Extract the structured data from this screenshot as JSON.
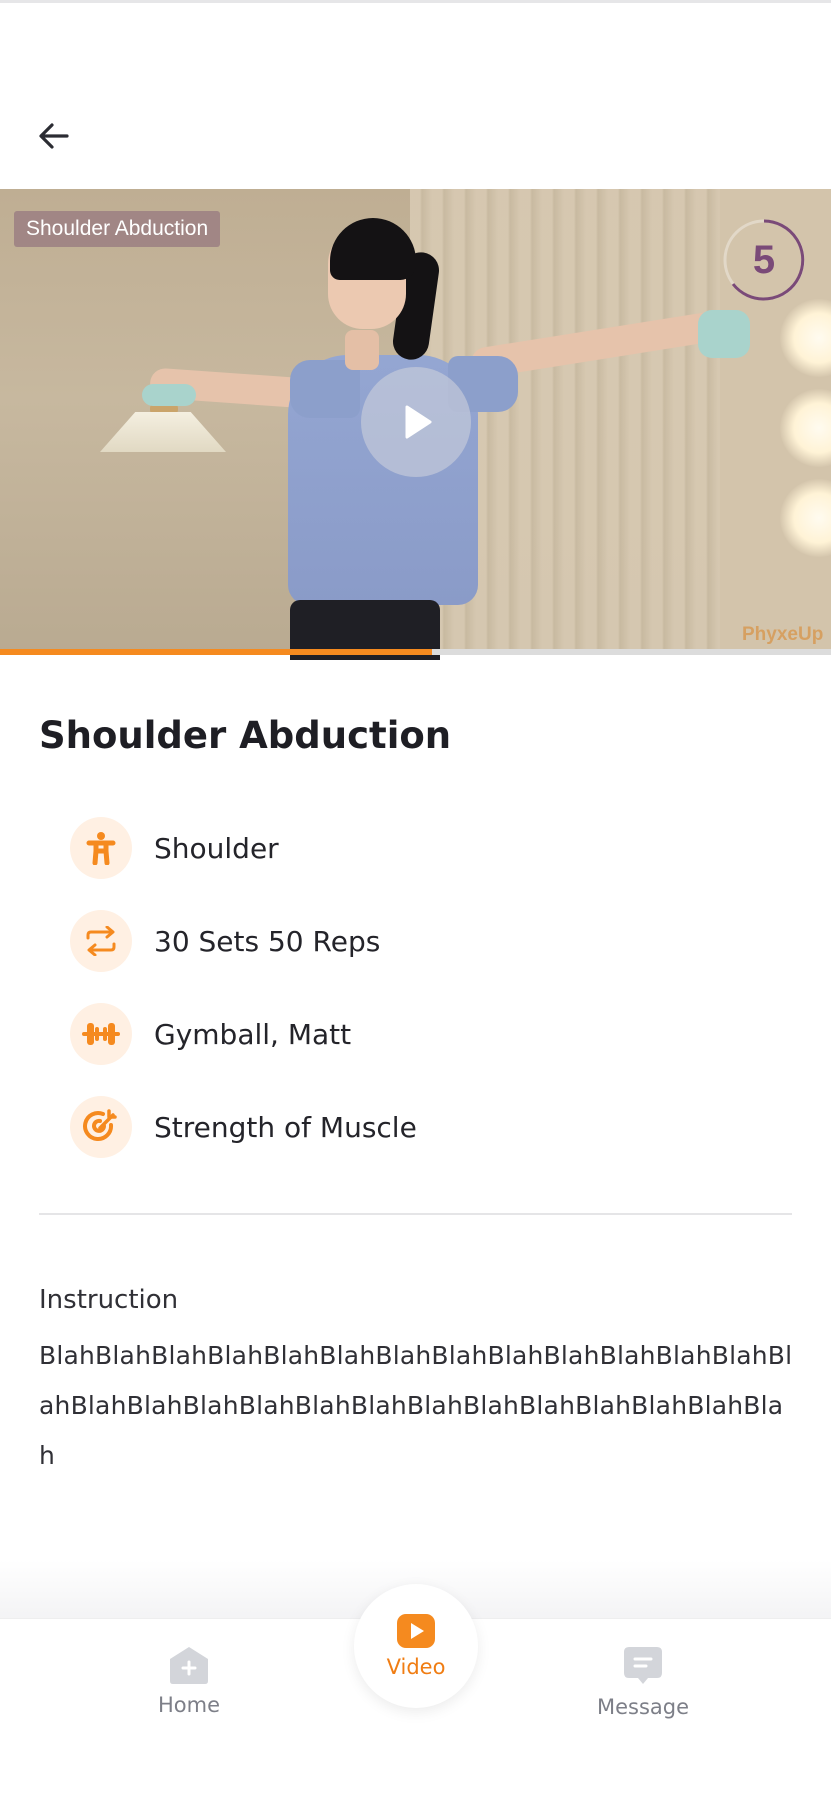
{
  "header": {
    "back_icon": "arrow-left-icon"
  },
  "video": {
    "overlay_title": "Shoulder Abduction",
    "counter": "5",
    "watermark": "PhyxeUp",
    "play_icon": "play-icon",
    "progress_fraction": 0.52,
    "accent_color": "#f58a1f"
  },
  "exercise": {
    "title": "Shoulder Abduction",
    "details": [
      {
        "icon": "person-icon",
        "text": "Shoulder"
      },
      {
        "icon": "repeat-icon",
        "text": "30 Sets 50 Reps"
      },
      {
        "icon": "dumbbell-icon",
        "text": "Gymball, Matt"
      },
      {
        "icon": "target-icon",
        "text": "Strength of Muscle"
      }
    ]
  },
  "instruction": {
    "label": "Instruction",
    "body": "BlahBlahBlahBlahBlahBlahBlahBlahBlahBlahBlahBlahBlahBlahBlahBlahBlahBlahBlahBlahBlahBlahBlahBlahBlahBlahBlah"
  },
  "nav": {
    "home_label": "Home",
    "video_label": "Video",
    "message_label": "Message",
    "active": "Video",
    "active_color": "#f07d13",
    "inactive_color": "#7d7f88"
  }
}
